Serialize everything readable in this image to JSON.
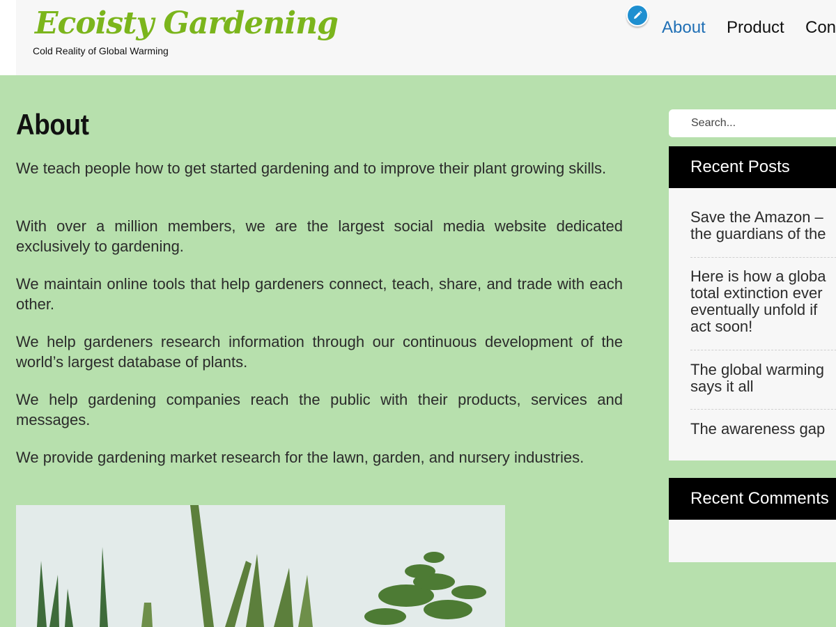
{
  "site": {
    "title": "Ecoisty Gardening",
    "tagline": "Cold Reality of Global Warming"
  },
  "nav": {
    "items": [
      {
        "label": "About",
        "active": true
      },
      {
        "label": "Product",
        "active": false
      },
      {
        "label": "Con",
        "active": false
      }
    ]
  },
  "page": {
    "title": "About",
    "paragraphs": [
      "We teach people how to get started gardening and to improve their plant growing skills.",
      "With over a million members, we are the largest social media website dedicated exclusively to gardening.",
      "We maintain online tools that help gardeners connect, teach, share, and trade with each other.",
      "We help gardeners research information through our continuous development of the world’s largest database of plants.",
      "We help gardening companies reach the public with their products, services and messages.",
      "We provide gardening market research for the lawn, garden, and nursery industries."
    ]
  },
  "sidebar": {
    "search_placeholder": "Search...",
    "recent_posts_title": "Recent Posts",
    "recent_posts": [
      {
        "line1": "Save the Amazon –",
        "line2": "the guardians of the"
      },
      {
        "line1": "Here is how a globa",
        "line2": "total extinction ever",
        "line3": "eventually unfold if",
        "line4": "act soon!"
      },
      {
        "line1": "The global warming",
        "line2": "says it all"
      },
      {
        "line1": "The awareness gap"
      }
    ],
    "recent_comments_title": "Recent Comments"
  },
  "colors": {
    "background": "#b7e0ad",
    "logo": "#7bb51c",
    "nav_active": "#1f6fb5",
    "widget_header": "#000000"
  },
  "icons": {
    "edit": "pencil-icon"
  }
}
